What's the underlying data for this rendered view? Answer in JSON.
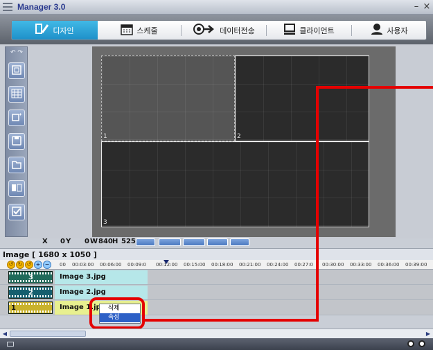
{
  "window": {
    "title": "Manager 3.0",
    "minimize": "–",
    "close": "×"
  },
  "tabs": [
    {
      "label": "디자인",
      "icon": "design-icon",
      "active": true
    },
    {
      "label": "스케줄",
      "icon": "calendar-icon",
      "active": false
    },
    {
      "label": "데이터전송",
      "icon": "transfer-icon",
      "active": false
    },
    {
      "label": "클라이언트",
      "icon": "monitor-icon",
      "active": false
    },
    {
      "label": "사용자",
      "icon": "user-icon",
      "active": false
    }
  ],
  "toolstrip": {
    "undo_label": "↶ ↷"
  },
  "regions": [
    {
      "number": "1"
    },
    {
      "number": "2"
    },
    {
      "number": "3"
    }
  ],
  "coords": {
    "x_label": "X",
    "x_value": "0",
    "y_label": "Y",
    "y_value": "0",
    "w_label": "W",
    "w_value": "840",
    "h_label": "H",
    "h_value": "525"
  },
  "image_label": "Image  [ 1680 x 1050 ]",
  "ruler": {
    "ticks": [
      "00",
      "00:03:00",
      "00:06:00",
      "00:09:0",
      "00:12:00",
      "00:15:00",
      "00:18:00",
      "00:21:00",
      "00:24:00",
      "00:27:0",
      "00:30:00",
      "00:33:00",
      "00:36:00",
      "00:39:00"
    ]
  },
  "tracks": [
    {
      "name": "Image 3.jpg",
      "num": "3"
    },
    {
      "name": "Image 2.jpg",
      "num": "2"
    },
    {
      "name": "Image 1.jpg",
      "num": "1"
    }
  ],
  "context_menu": {
    "delete": "삭제",
    "properties": "속성"
  },
  "colors": {
    "accent": "#1e90c9",
    "highlight": "#e40000",
    "menu_selected": "#2d60c6"
  }
}
